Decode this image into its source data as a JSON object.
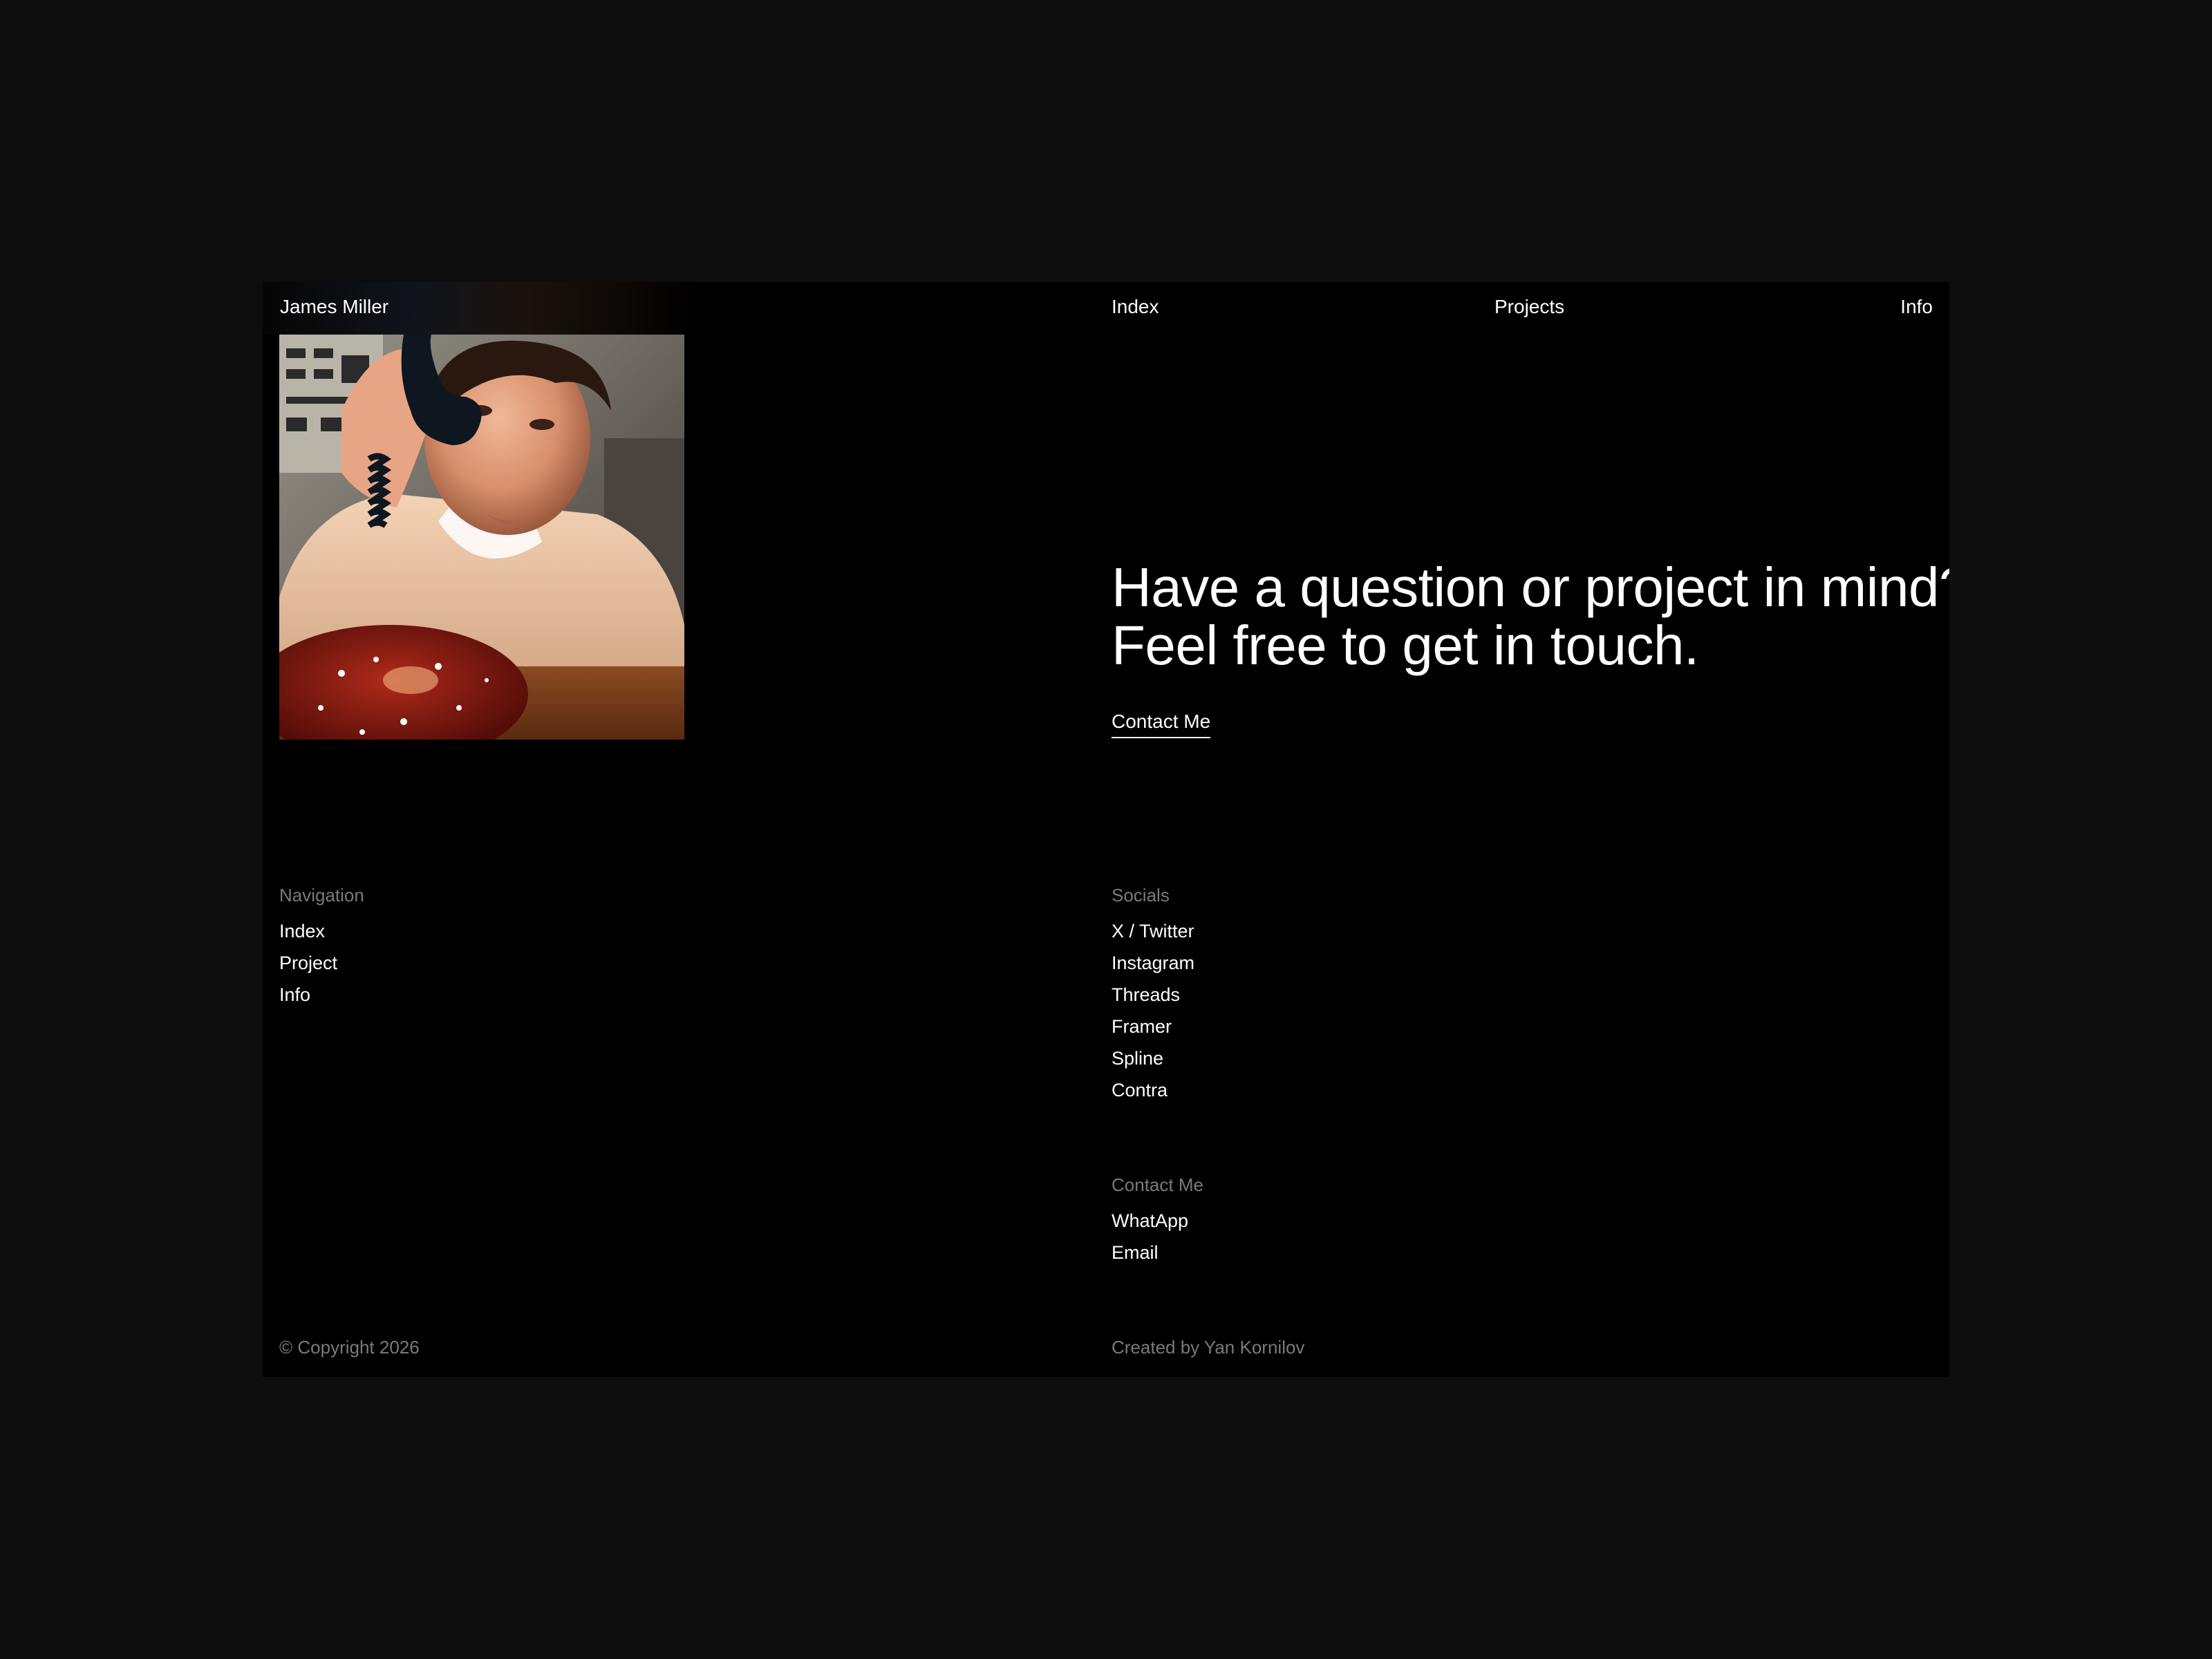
{
  "header": {
    "brand": "James Miller",
    "nav": [
      "Index",
      "Projects",
      "Info"
    ]
  },
  "hero": {
    "headline_line1": "Have a question or project in mind?",
    "headline_line2": "Feel free to get in touch.",
    "cta": "Contact Me",
    "photo_alt": "portrait-photo"
  },
  "footer": {
    "navigation": {
      "title": "Navigation",
      "items": [
        "Index",
        "Project",
        "Info"
      ]
    },
    "socials": {
      "title": "Socials",
      "items": [
        "X / Twitter",
        "Instagram",
        "Threads",
        "Framer",
        "Spline",
        "Contra"
      ]
    },
    "contact": {
      "title": "Contact Me",
      "items": [
        "WhatApp",
        "Email"
      ]
    },
    "copyright": "© Copyright 2026",
    "credit": "Created by Yan Kornilov"
  },
  "colors": {
    "page_bg": "#0d0d0d",
    "frame_bg": "#000000",
    "text": "#ffffff",
    "muted": "#7a7a7a"
  }
}
